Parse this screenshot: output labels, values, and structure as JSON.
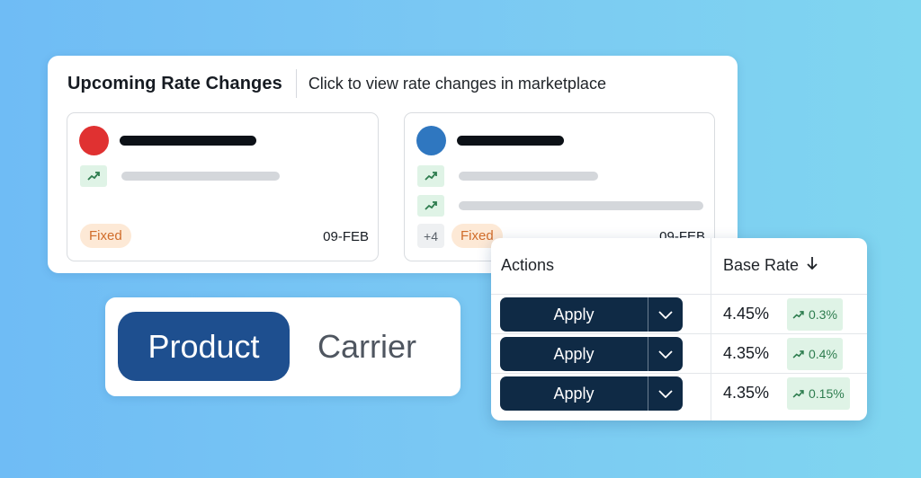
{
  "rate_panel": {
    "title": "Upcoming Rate Changes",
    "subtitle": "Click to view rate changes in marketplace",
    "cards": [
      {
        "dot_color": "#e03131",
        "trend_rows": 1,
        "type_label": "Fixed",
        "date": "09-FEB",
        "trend_icon": "trending-up-icon"
      },
      {
        "dot_color": "#2f77c0",
        "trend_rows": 2,
        "more_label": "+4",
        "type_label": "Fixed",
        "date": "09-FEB",
        "trend_icon": "trending-up-icon"
      }
    ]
  },
  "toggle": {
    "options": [
      "Product",
      "Carrier"
    ],
    "selected": "Product"
  },
  "table": {
    "headers": {
      "actions": "Actions",
      "base_rate": "Base Rate"
    },
    "sort": {
      "column": "base_rate",
      "direction": "descending",
      "icon": "arrow-down-icon"
    },
    "rows": [
      {
        "action": "Apply",
        "rate": "4.45%",
        "change": "0.3%"
      },
      {
        "action": "Apply",
        "rate": "4.35%",
        "change": "0.4%"
      },
      {
        "action": "Apply",
        "rate": "4.35%",
        "change": "0.15%"
      }
    ]
  },
  "colors": {
    "background": "#74c2f4",
    "accent_blue": "#1e4f8f",
    "button_navy": "#0f2a45",
    "positive_green": "#2e7d4f",
    "fixed_orange": "#d06c2a"
  }
}
